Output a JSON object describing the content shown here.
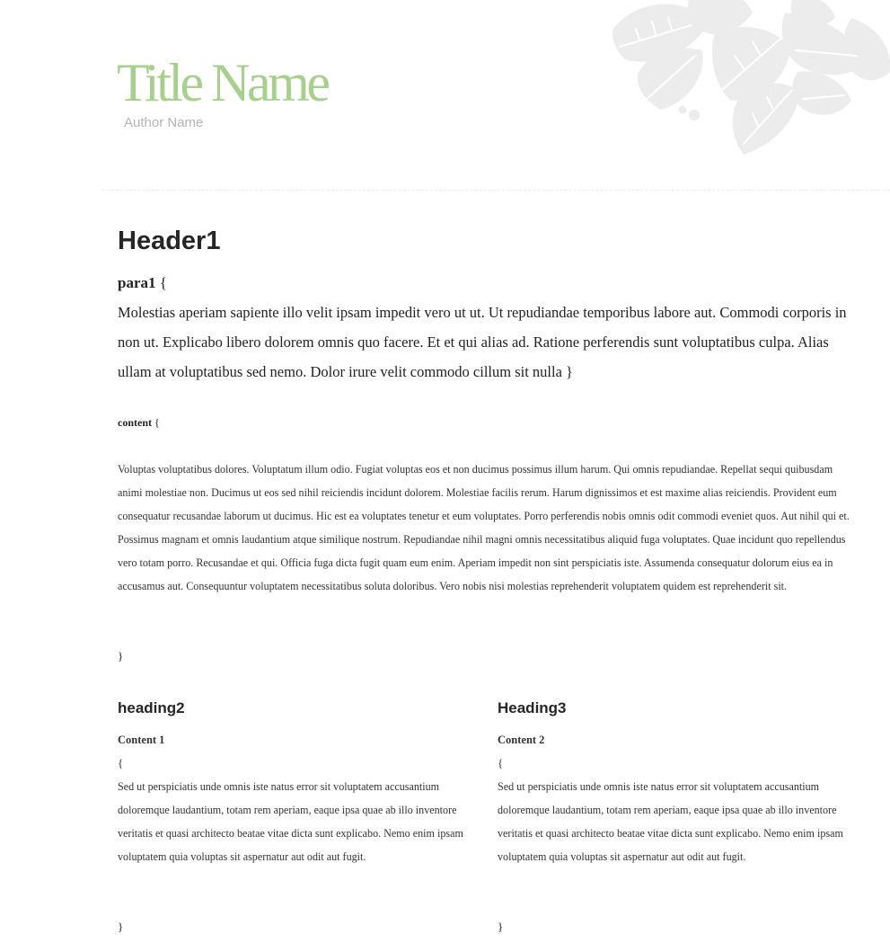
{
  "header": {
    "title": "Title Name",
    "author": "Author Name"
  },
  "colors": {
    "title": "#a8d08d",
    "author": "#b4b4b4",
    "decoration": "#ececec",
    "divider": "#ececec"
  },
  "section1": {
    "heading": "Header1",
    "para1_label": "para1",
    "open_brace": "{",
    "para1_text": "Molestias aperiam sapiente illo velit ipsam impedit vero ut ut. Ut repudiandae temporibus labore aut. Commodi corporis in non ut. Explicabo libero dolorem omnis quo facere. Et et qui alias ad. Ratione perferendis sunt voluptatibus culpa. Alias ullam at voluptatibus sed nemo. Dolor irure velit commodo cillum sit nulla }",
    "content_label": "content",
    "content_text": "Voluptas voluptatibus dolores. Voluptatum illum odio. Fugiat voluptas eos et non ducimus possimus illum harum. Qui omnis repudiandae. Repellat sequi quibusdam animi molestiae non. Ducimus ut eos sed nihil reiciendis incidunt dolorem. Molestiae facilis rerum. Harum dignissimos et est maxime alias reiciendis. Provident eum consequatur recusandae laborum ut ducimus. Hic est ea voluptates tenetur et eum voluptates. Porro perferendis nobis omnis odit commodi eveniet quos. Aut nihil qui et. Possimus magnam et omnis laudantium atque similique nostrum. Repudiandae nihil magni omnis necessitatibus aliquid fuga voluptates. Quae incidunt quo repellendus vero totam porro. Recusandae et qui. Officia fuga dicta fugit quam eum enim. Aperiam impedit non sint perspiciatis iste. Assumenda consequatur dolorum eius ea in accusamus aut. Consequuntur voluptatem necessitatibus soluta doloribus. Vero nobis nisi molestias reprehenderit voluptatem quidem est reprehenderit sit.",
    "close_brace": "}"
  },
  "columns": [
    {
      "heading": "heading2",
      "subheading": "Content 1",
      "open_brace": "{",
      "text": "Sed ut perspiciatis unde omnis iste natus error sit voluptatem accusantium doloremque laudantium, totam rem aperiam, eaque ipsa quae ab illo inventore veritatis et quasi architecto beatae vitae dicta sunt explicabo. Nemo enim ipsam voluptatem quia voluptas sit aspernatur aut odit aut fugit.",
      "close_brace": "}"
    },
    {
      "heading": "Heading3",
      "subheading": "Content 2",
      "open_brace": "{",
      "text": "Sed ut perspiciatis unde omnis iste natus error sit voluptatem accusantium doloremque laudantium, totam rem aperiam, eaque ipsa quae ab illo inventore veritatis et quasi architecto beatae vitae dicta sunt explicabo. Nemo enim ipsam voluptatem quia voluptas sit aspernatur aut odit aut fugit.",
      "close_brace": "}"
    }
  ]
}
